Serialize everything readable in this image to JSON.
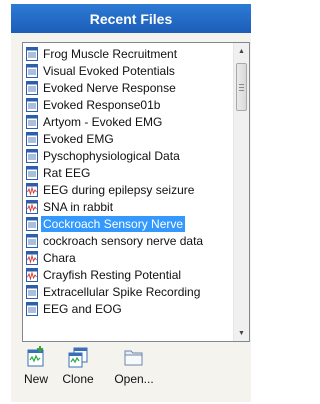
{
  "header": {
    "title": "Recent Files"
  },
  "files": [
    {
      "label": "Frog Muscle Recruitment",
      "icon": "document-icon",
      "selected": false
    },
    {
      "label": "Visual Evoked Potentials",
      "icon": "document-icon",
      "selected": false
    },
    {
      "label": "Evoked Nerve Response",
      "icon": "document-icon",
      "selected": false
    },
    {
      "label": "Evoked Response01b",
      "icon": "document-icon",
      "selected": false
    },
    {
      "label": "Artyom - Evoked EMG",
      "icon": "document-icon",
      "selected": false
    },
    {
      "label": "Evoked EMG",
      "icon": "document-icon",
      "selected": false
    },
    {
      "label": "Pyschophysiological Data",
      "icon": "document-icon",
      "selected": false
    },
    {
      "label": "Rat EEG",
      "icon": "document-icon",
      "selected": false
    },
    {
      "label": "EEG during epilepsy seizure",
      "icon": "waveform-document-icon",
      "selected": false
    },
    {
      "label": "SNA in rabbit",
      "icon": "waveform-document-icon",
      "selected": false
    },
    {
      "label": "Cockroach Sensory Nerve",
      "icon": "document-icon",
      "selected": true
    },
    {
      "label": "cockroach sensory nerve data",
      "icon": "document-icon",
      "selected": false
    },
    {
      "label": "Chara",
      "icon": "waveform-document-icon",
      "selected": false
    },
    {
      "label": "Crayfish Resting Potential",
      "icon": "waveform-document-icon",
      "selected": false
    },
    {
      "label": "Extracellular Spike Recording",
      "icon": "document-icon",
      "selected": false
    },
    {
      "label": "EEG and EOG",
      "icon": "document-icon",
      "selected": false
    }
  ],
  "toolbar": {
    "new_label": "New",
    "clone_label": "Clone",
    "open_label": "Open..."
  },
  "colors": {
    "header": "#1f63bd",
    "selection": "#3399ff",
    "panel": "#f4f3ee"
  }
}
